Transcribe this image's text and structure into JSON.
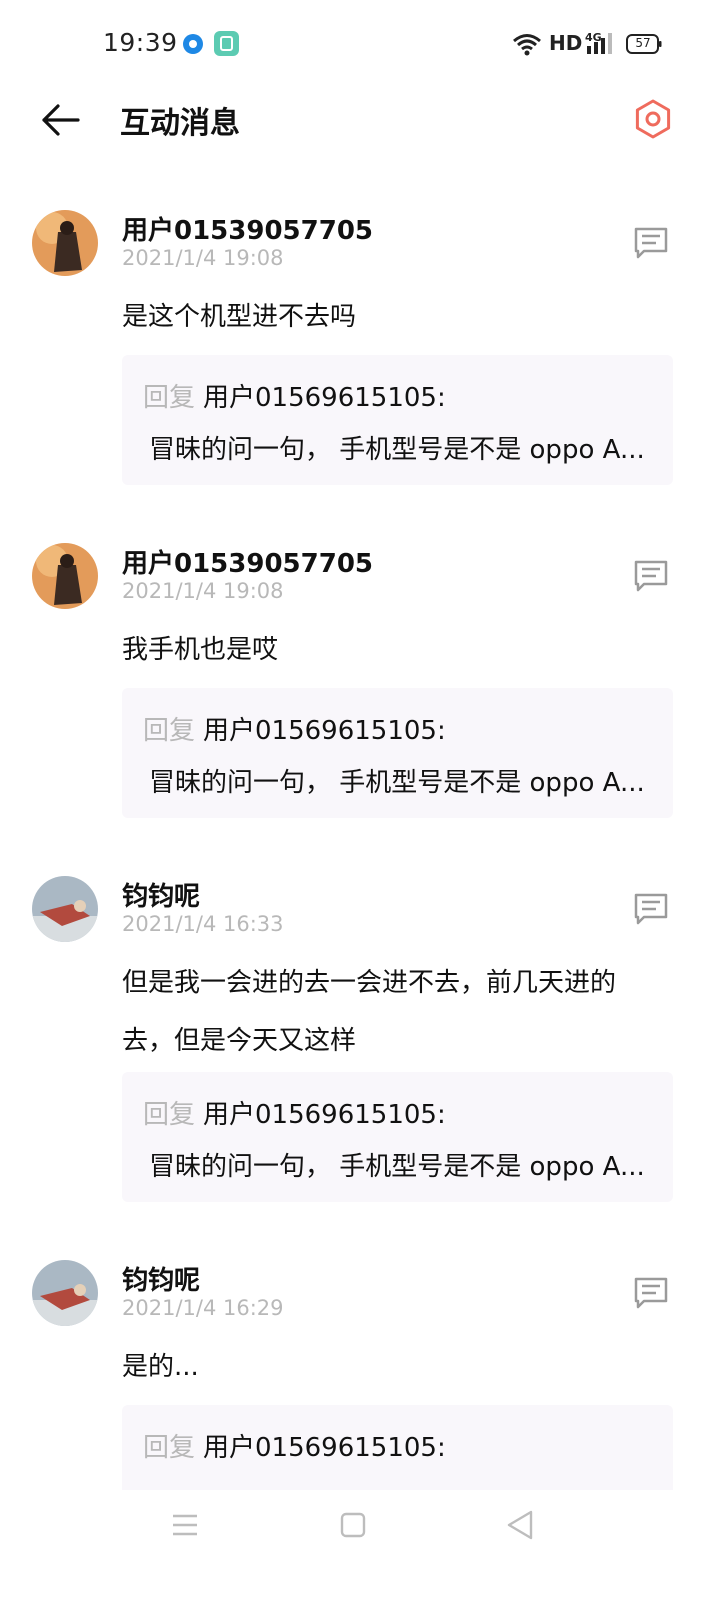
{
  "status_bar": {
    "time": "19:39",
    "network": "HD",
    "signal_label": "4G",
    "battery": "57"
  },
  "header": {
    "title": "互动消息",
    "back_icon": "arrow-left-icon",
    "settings_icon": "hexagon-settings-icon"
  },
  "colors": {
    "accent": "#ef6b5d",
    "timestamp": "#b8b8b8",
    "quote_bg": "#f9f7fb"
  },
  "messages": [
    {
      "username": "用户01539057705",
      "time": "2021/1/4 19:08",
      "content": "是这个机型进不去吗",
      "quote_label": "回复",
      "quote_user": "用户01569615105:",
      "quote_text": "冒昧的问一句， 手机型号是不是 oppo A..."
    },
    {
      "username": "用户01539057705",
      "time": "2021/1/4 19:08",
      "content": "我手机也是哎",
      "quote_label": "回复",
      "quote_user": "用户01569615105:",
      "quote_text": "冒昧的问一句， 手机型号是不是 oppo A..."
    },
    {
      "username": "钧钧呢",
      "time": "2021/1/4 16:33",
      "content": "但是我一会进的去一会进不去，前几天进的去，但是今天又这样",
      "quote_label": "回复",
      "quote_user": "用户01569615105:",
      "quote_text": "冒昧的问一句， 手机型号是不是 oppo A..."
    },
    {
      "username": "钧钧呢",
      "time": "2021/1/4 16:29",
      "content": "是的...",
      "quote_label": "回复",
      "quote_user": "用户01569615105:",
      "quote_text": ""
    }
  ],
  "nav": {
    "menu_icon": "menu-icon",
    "home_icon": "home-square-icon",
    "back_icon": "back-triangle-icon"
  }
}
